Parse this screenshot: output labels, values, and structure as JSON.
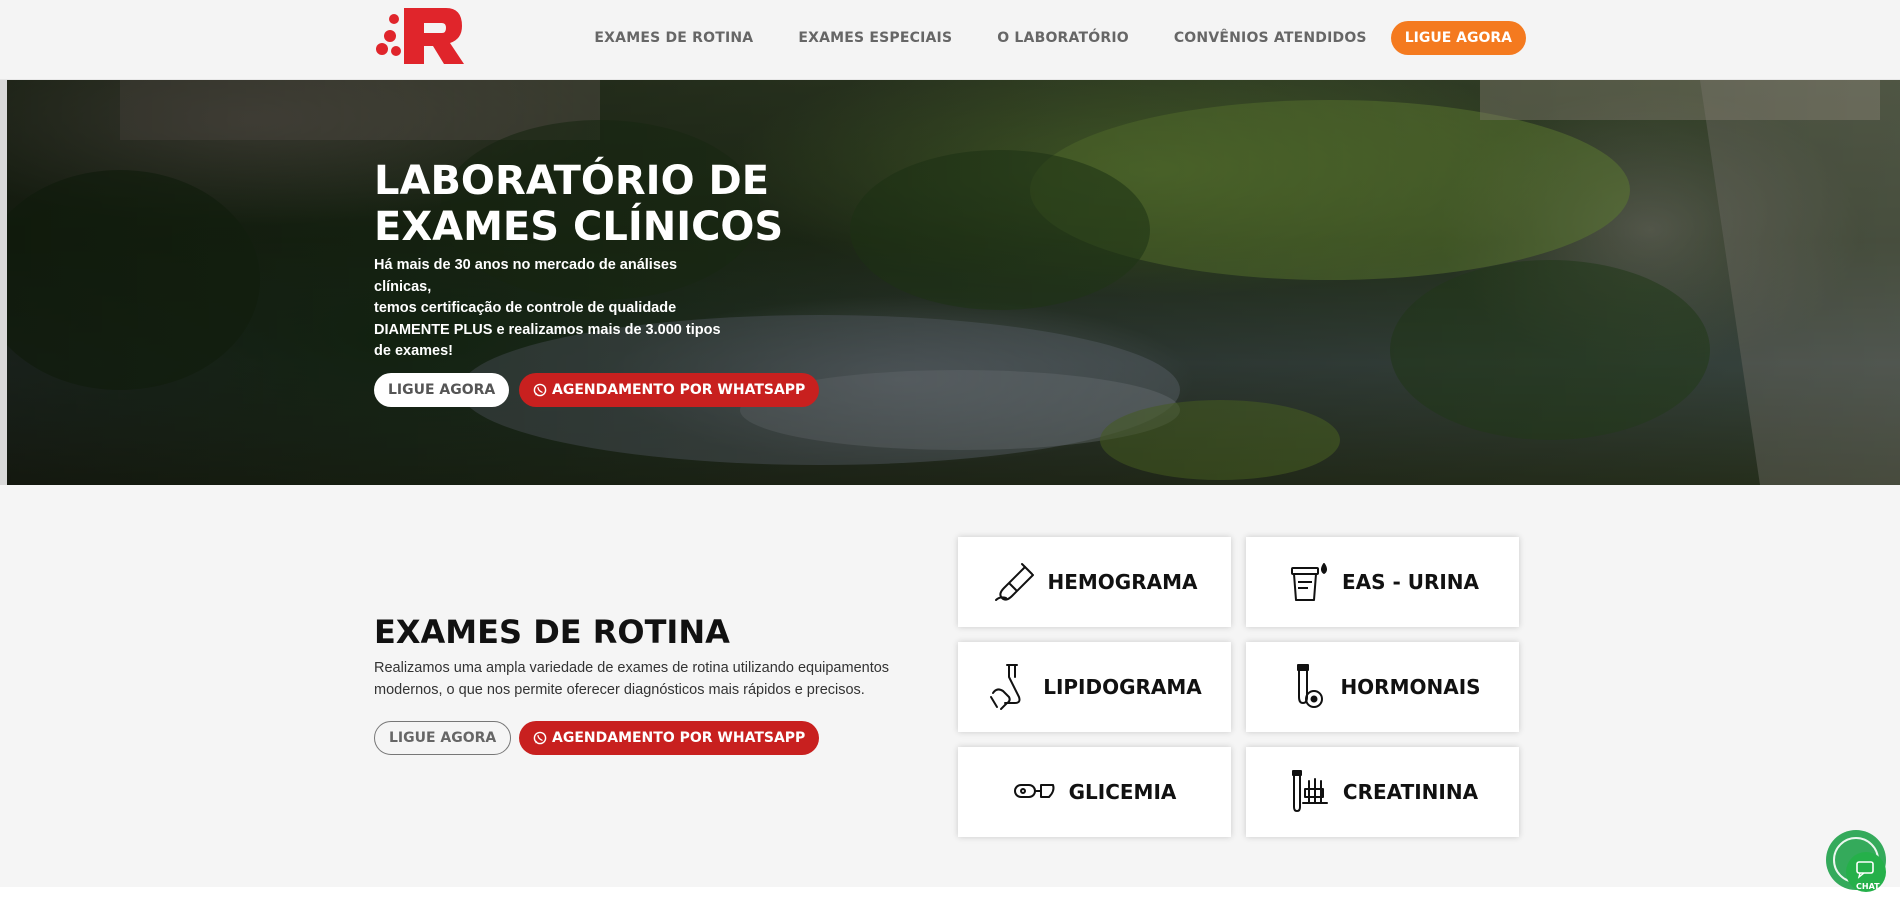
{
  "header": {
    "logo_name": "logo-r",
    "brand_color": "#e0252b",
    "nav": [
      {
        "label": "EXAMES DE ROTINA"
      },
      {
        "label": "EXAMES ESPECIAIS"
      },
      {
        "label": "O LABORATÓRIO"
      },
      {
        "label": "CONVÊNIOS ATENDIDOS"
      }
    ],
    "cta_label": "LIGUE AGORA",
    "cta_color": "#f47a1f"
  },
  "hero": {
    "title_line1": "LABORATÓRIO DE",
    "title_line2": "EXAMES CLÍNICOS",
    "text_lines": [
      "Há mais de 30 anos no mercado de análises clínicas,",
      "temos certificação de controle de qualidade",
      "DIAMENTE PLUS e realizamos mais de 3.000 tipos",
      "de exames!"
    ],
    "call_label": "LIGUE AGORA",
    "whatsapp_label": "AGENDAMENTO POR WHATSAPP"
  },
  "routine": {
    "title": "EXAMES DE ROTINA",
    "text_lines": [
      "Realizamos uma ampla variedade de exames de rotina utilizando equipamentos",
      "modernos, o que nos permite oferecer diagnósticos mais rápidos e precisos."
    ],
    "call_label": "LIGUE AGORA",
    "whatsapp_label": "AGENDAMENTO POR WHATSAPP",
    "cards": [
      {
        "label": "HEMOGRAMA",
        "icon": "test-tube-icon"
      },
      {
        "label": "EAS - URINA",
        "icon": "urine-cup-icon"
      },
      {
        "label": "LIPIDOGRAMA",
        "icon": "hand-flask-icon"
      },
      {
        "label": "HORMONAIS",
        "icon": "tube-hormone-icon"
      },
      {
        "label": "GLICEMIA",
        "icon": "glucose-meter-icon"
      },
      {
        "label": "CREATININA",
        "icon": "tubes-rack-icon"
      }
    ]
  },
  "chat": {
    "label": "CHAT",
    "color": "#25b04a"
  }
}
